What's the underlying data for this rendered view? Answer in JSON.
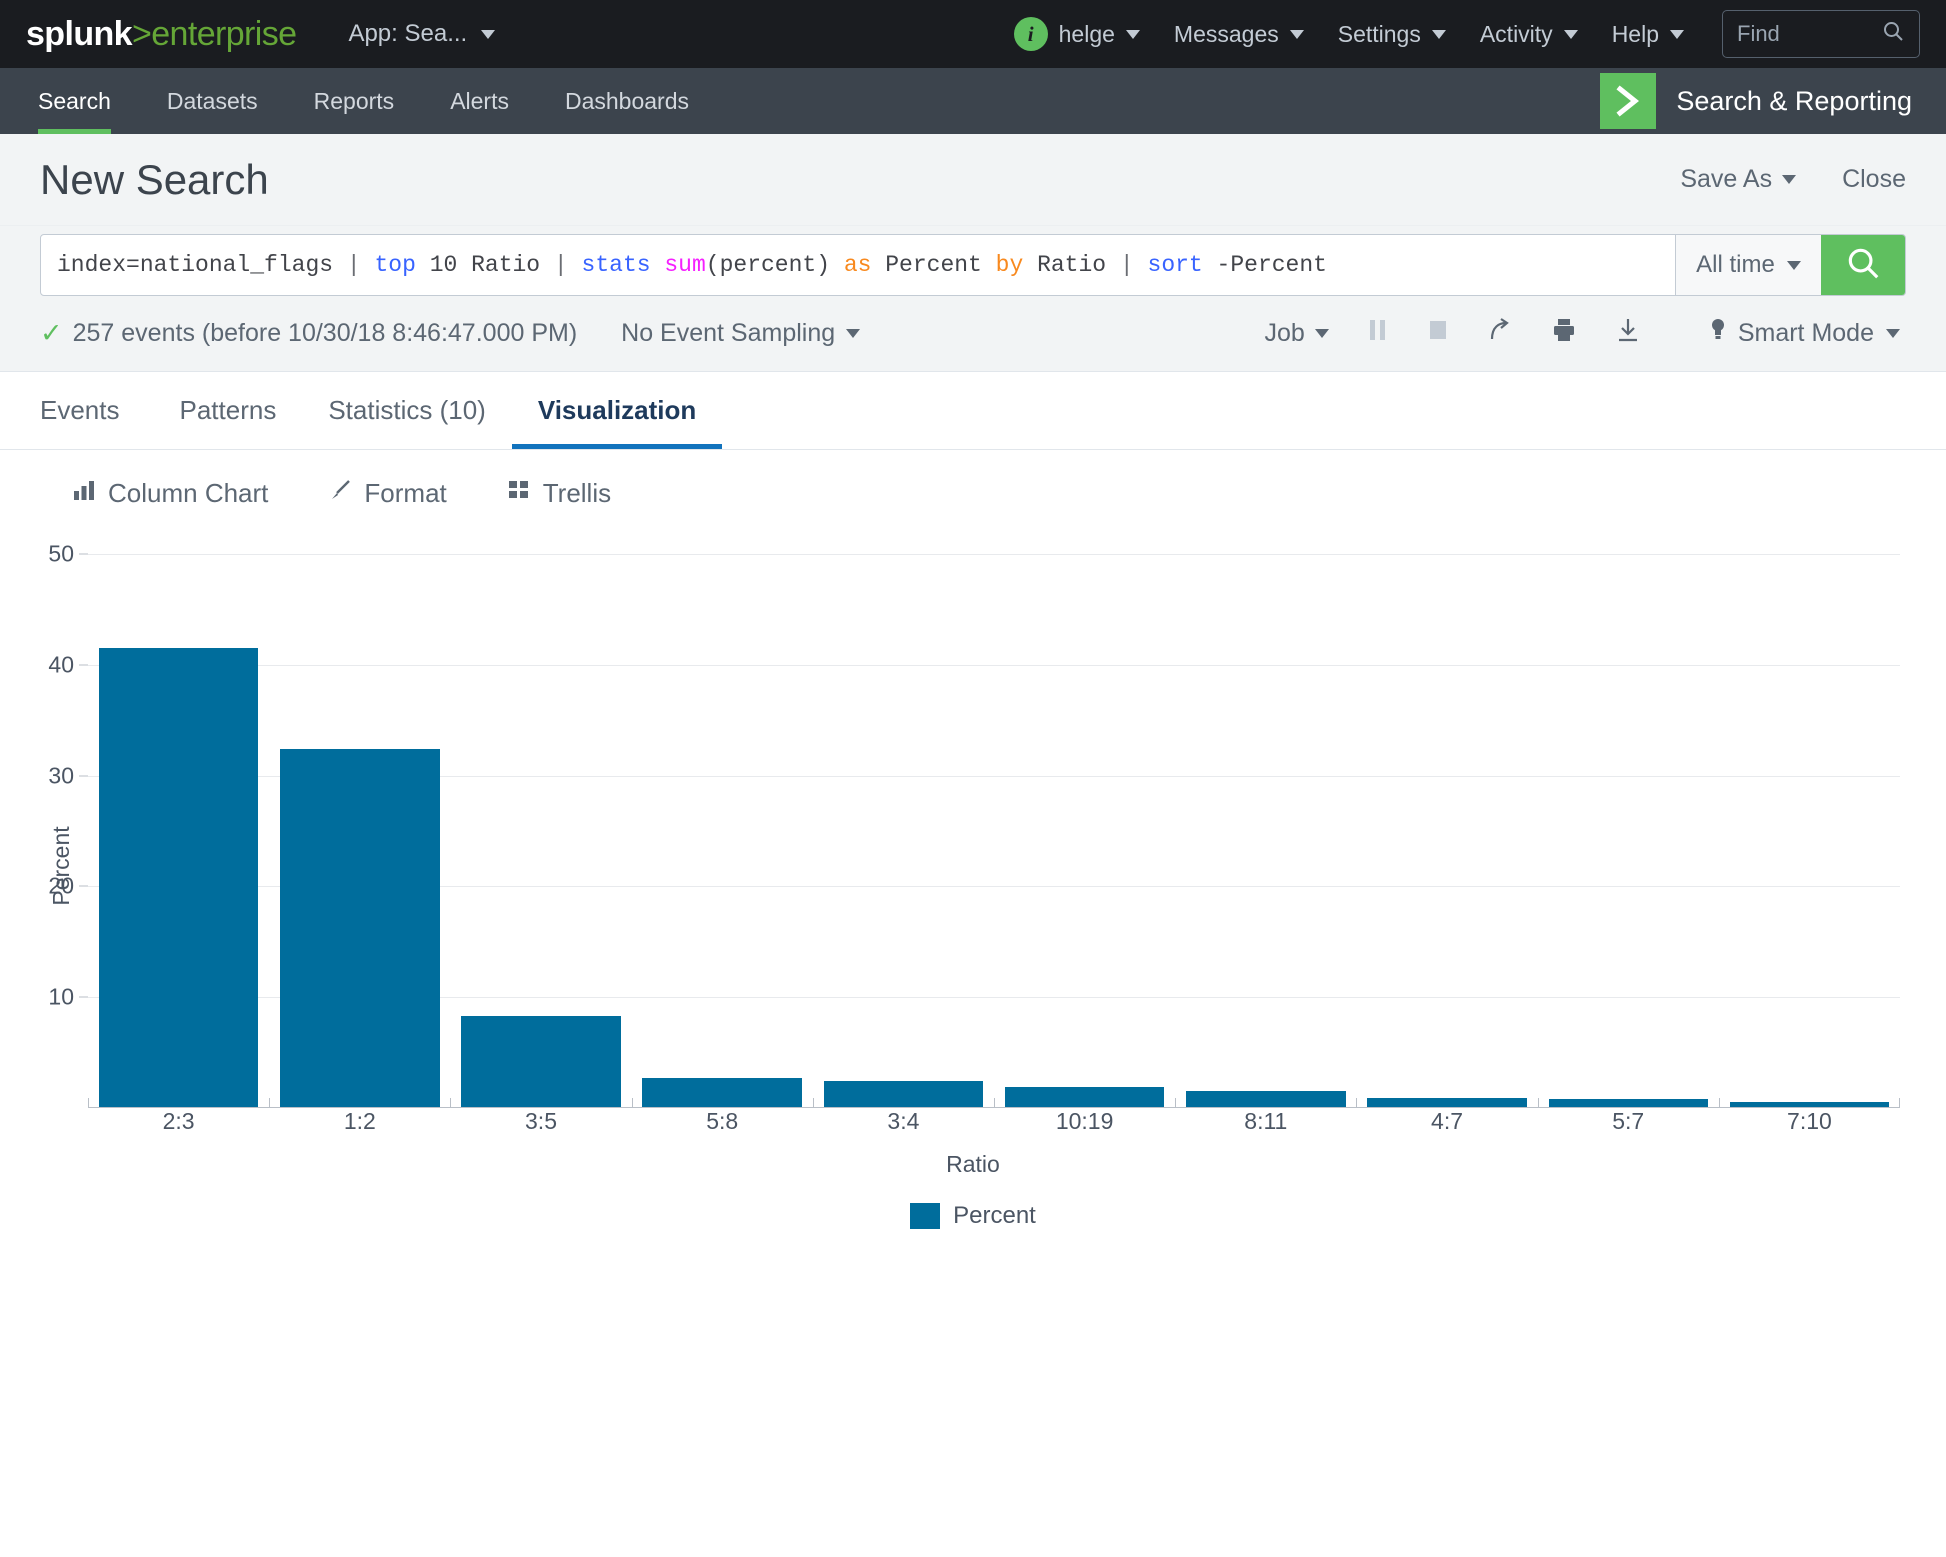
{
  "topbar": {
    "logo_main": "splunk",
    "logo_gt": ">",
    "logo_sub": "enterprise",
    "app_label": "App: Sea...",
    "user_badge": "i",
    "user": "helge",
    "messages": "Messages",
    "settings": "Settings",
    "activity": "Activity",
    "help": "Help",
    "find_placeholder": "Find"
  },
  "appnav": {
    "items": [
      {
        "label": "Search",
        "active": true
      },
      {
        "label": "Datasets",
        "active": false
      },
      {
        "label": "Reports",
        "active": false
      },
      {
        "label": "Alerts",
        "active": false
      },
      {
        "label": "Dashboards",
        "active": false
      }
    ],
    "app_title": "Search & Reporting"
  },
  "page": {
    "title": "New Search",
    "save_as": "Save As",
    "close": "Close"
  },
  "search": {
    "query_full": "index=national_flags | top 10 Ratio | stats sum(percent) as Percent by Ratio | sort -Percent",
    "tokens": [
      {
        "t": "index=national_flags ",
        "c": "plain"
      },
      {
        "t": "| ",
        "c": "pipe"
      },
      {
        "t": "top ",
        "c": "cmd"
      },
      {
        "t": "10 Ratio ",
        "c": "plain"
      },
      {
        "t": "| ",
        "c": "pipe"
      },
      {
        "t": "stats ",
        "c": "cmd"
      },
      {
        "t": "sum",
        "c": "fn"
      },
      {
        "t": "(percent) ",
        "c": "plain"
      },
      {
        "t": "as ",
        "c": "kw"
      },
      {
        "t": "Percent ",
        "c": "plain"
      },
      {
        "t": "by ",
        "c": "kw"
      },
      {
        "t": "Ratio ",
        "c": "plain"
      },
      {
        "t": "| ",
        "c": "pipe"
      },
      {
        "t": "sort ",
        "c": "cmd"
      },
      {
        "t": "-Percent",
        "c": "plain"
      }
    ],
    "time_range": "All time",
    "search_icon": "magnifier-icon"
  },
  "job": {
    "events_text": "257 events (before 10/30/18 8:46:47.000 PM)",
    "sampling": "No Event Sampling",
    "job_label": "Job",
    "pause_icon": "pause-icon",
    "stop_icon": "stop-icon",
    "share_icon": "share-icon",
    "print_icon": "print-icon",
    "export_icon": "export-icon",
    "smart_mode": "Smart Mode"
  },
  "tabs": [
    {
      "label": "Events",
      "active": false
    },
    {
      "label": "Patterns",
      "active": false
    },
    {
      "label": "Statistics (10)",
      "active": false
    },
    {
      "label": "Visualization",
      "active": true
    }
  ],
  "viz_toolbar": [
    {
      "label": "Column Chart",
      "icon": "bar-chart-icon"
    },
    {
      "label": "Format",
      "icon": "paintbrush-icon"
    },
    {
      "label": "Trellis",
      "icon": "grid-icon"
    }
  ],
  "chart_data": {
    "type": "bar",
    "title": "",
    "categories": [
      "2:3",
      "1:2",
      "3:5",
      "5:8",
      "3:4",
      "10:19",
      "8:11",
      "4:7",
      "5:7",
      "7:10"
    ],
    "values": [
      41.5,
      32.4,
      8.3,
      2.7,
      2.4,
      1.9,
      1.5,
      0.9,
      0.8,
      0.5
    ],
    "series": [
      {
        "name": "Percent",
        "values": [
          41.5,
          32.4,
          8.3,
          2.7,
          2.4,
          1.9,
          1.5,
          0.9,
          0.8,
          0.5
        ]
      }
    ],
    "xlabel": "Ratio",
    "ylabel": "Percent",
    "ylim": [
      0,
      50
    ],
    "yticks": [
      10,
      20,
      30,
      40,
      50
    ],
    "grid": true,
    "legend": [
      "Percent"
    ],
    "legend_position": "bottom",
    "bar_color": "#006d9c"
  },
  "colors": {
    "brand_green": "#5fbf5f",
    "bar_blue": "#006d9c",
    "tab_accent": "#1273bd",
    "topbar_bg": "#1a1c20",
    "appnav_bg": "#3c444d"
  }
}
